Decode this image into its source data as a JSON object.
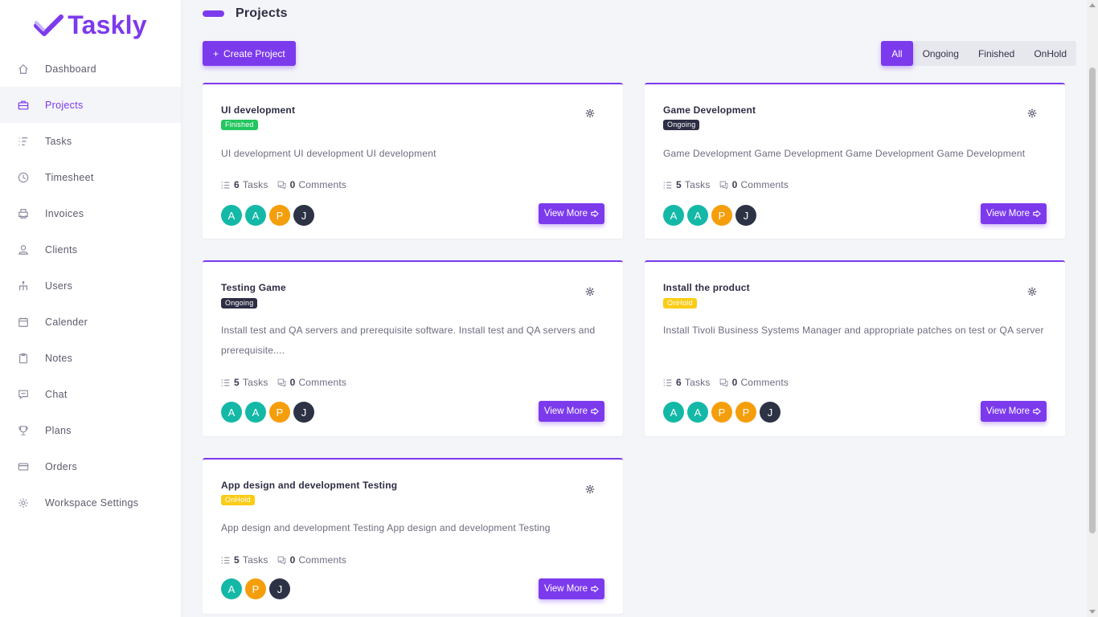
{
  "brand": {
    "name": "Taskly",
    "color": "#7c3aed"
  },
  "sidebar": {
    "items": [
      {
        "label": "Dashboard",
        "icon": "home-icon",
        "active": false
      },
      {
        "label": "Projects",
        "icon": "briefcase-icon",
        "active": true
      },
      {
        "label": "Tasks",
        "icon": "list-icon",
        "active": false
      },
      {
        "label": "Timesheet",
        "icon": "clock-icon",
        "active": false
      },
      {
        "label": "Invoices",
        "icon": "printer-icon",
        "active": false
      },
      {
        "label": "Clients",
        "icon": "user-icon",
        "active": false
      },
      {
        "label": "Users",
        "icon": "sitemap-icon",
        "active": false
      },
      {
        "label": "Calender",
        "icon": "calendar-icon",
        "active": false
      },
      {
        "label": "Notes",
        "icon": "clipboard-icon",
        "active": false
      },
      {
        "label": "Chat",
        "icon": "chat-icon",
        "active": false
      },
      {
        "label": "Plans",
        "icon": "trophy-icon",
        "active": false
      },
      {
        "label": "Orders",
        "icon": "credit-card-icon",
        "active": false
      },
      {
        "label": "Workspace Settings",
        "icon": "gear-icon",
        "active": false
      }
    ]
  },
  "header": {
    "title": "Projects"
  },
  "toolbar": {
    "create_label": "Create Project",
    "create_prefix": "+"
  },
  "filters": [
    {
      "label": "All",
      "active": true
    },
    {
      "label": "Ongoing",
      "active": false
    },
    {
      "label": "Finished",
      "active": false
    },
    {
      "label": "OnHold",
      "active": false
    }
  ],
  "projects": [
    {
      "title": "UI development",
      "status": "Finished",
      "description": "UI development UI development UI development",
      "tasks": "6",
      "tasks_label": "Tasks",
      "comments": "0",
      "comments_label": "Comments",
      "avatars": [
        "A",
        "A",
        "P",
        "J"
      ],
      "view_label": "View More"
    },
    {
      "title": "Game Development",
      "status": "Ongoing",
      "description": "Game Development Game Development Game Development Game Development",
      "tasks": "5",
      "tasks_label": "Tasks",
      "comments": "0",
      "comments_label": "Comments",
      "avatars": [
        "A",
        "A",
        "P",
        "J"
      ],
      "view_label": "View More"
    },
    {
      "title": "Testing Game",
      "status": "Ongoing",
      "description": "Install test and QA servers and prerequisite software. Install test and QA servers and prerequisite....",
      "tasks": "5",
      "tasks_label": "Tasks",
      "comments": "0",
      "comments_label": "Comments",
      "avatars": [
        "A",
        "A",
        "P",
        "J"
      ],
      "view_label": "View More"
    },
    {
      "title": "Install the product",
      "status": "OnHold",
      "description": "Install Tivoli Business Systems Manager and appropriate patches on test or QA server",
      "tasks": "6",
      "tasks_label": "Tasks",
      "comments": "0",
      "comments_label": "Comments",
      "avatars": [
        "A",
        "A",
        "P",
        "P",
        "J"
      ],
      "view_label": "View More"
    },
    {
      "title": "App design and development Testing",
      "status": "OnHold",
      "description": "App design and development Testing App design and development Testing",
      "tasks": "5",
      "tasks_label": "Tasks",
      "comments": "0",
      "comments_label": "Comments",
      "avatars": [
        "A",
        "P",
        "J"
      ],
      "view_label": "View More"
    }
  ],
  "colors": {
    "accent": "#7c3aed",
    "finished": "#22c55e",
    "ongoing": "#2d2d44",
    "onhold": "#facc15",
    "avatar_a": "#14b8a6",
    "avatar_p": "#f59e0b",
    "avatar_j": "#2d3345"
  }
}
